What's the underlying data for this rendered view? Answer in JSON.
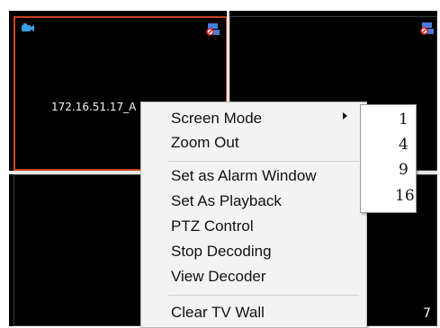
{
  "screens": {
    "top_left": {
      "label": "172.16.51.17_A",
      "selected": true
    },
    "bottom_right": {
      "number": "7"
    }
  },
  "context_menu": {
    "items": [
      {
        "label": "Screen Mode",
        "has_submenu": true
      },
      {
        "label": "Zoom Out"
      },
      {
        "label": "Set as Alarm Window"
      },
      {
        "label": "Set As Playback"
      },
      {
        "label": "PTZ Control"
      },
      {
        "label": "Stop Decoding"
      },
      {
        "label": "View Decoder"
      },
      {
        "label": "Clear TV Wall"
      }
    ]
  },
  "screen_mode_submenu": {
    "options": [
      "1",
      "4",
      "9",
      "16"
    ]
  },
  "icons": {
    "camera": "camera-icon",
    "status": "decoder-status-icon",
    "submenu_arrow": "chevron-right-icon"
  },
  "colors": {
    "selected_border": "#c8411c",
    "wall_background": "#000000",
    "menu_background": "#f3f3f3"
  }
}
